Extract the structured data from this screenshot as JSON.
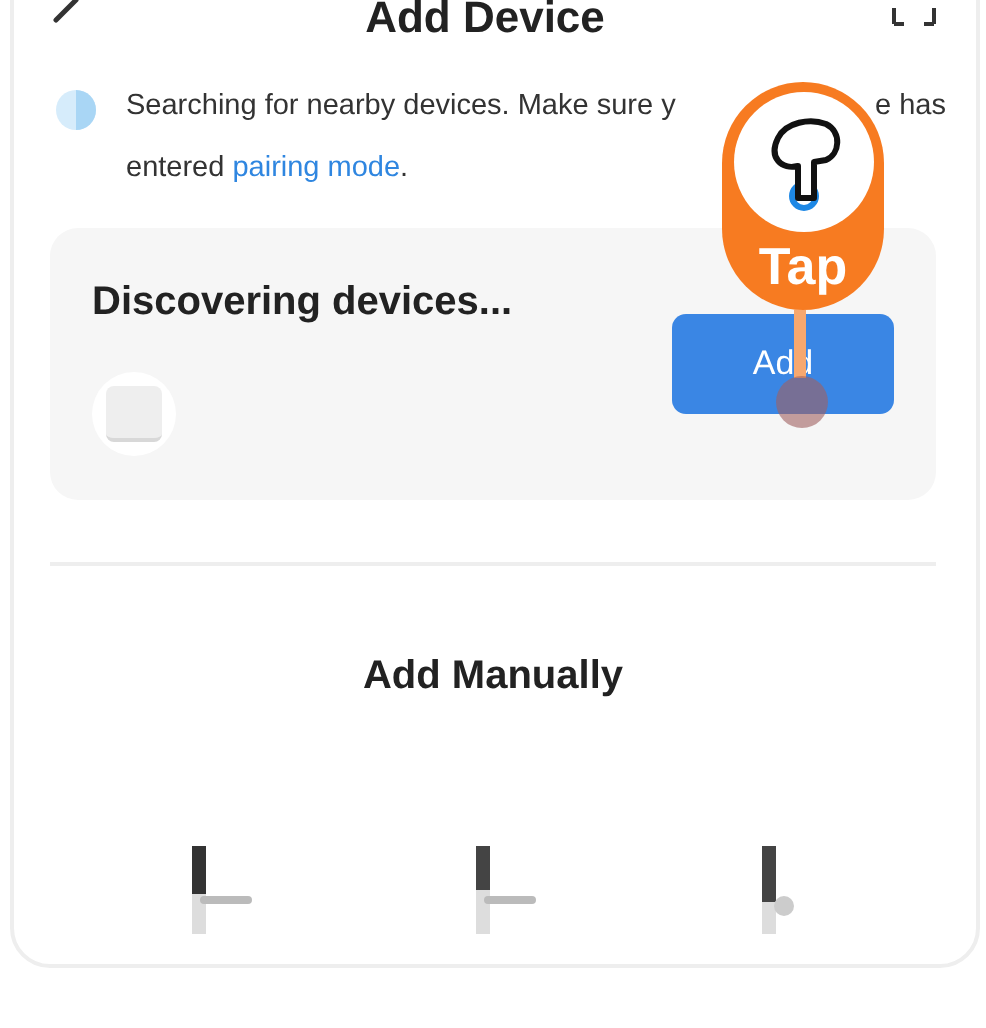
{
  "header": {
    "title": "Add Device"
  },
  "search_notice": {
    "line_start": "Searching for nearby devices. Make sure y",
    "line_end": "e has",
    "text": "entered ",
    "link": "pairing mode",
    "end": "."
  },
  "discovery_card": {
    "title": "Discovering devices...",
    "button": "Add"
  },
  "tap_hint": {
    "label": "Tap"
  },
  "manual": {
    "title": "Add Manually"
  }
}
